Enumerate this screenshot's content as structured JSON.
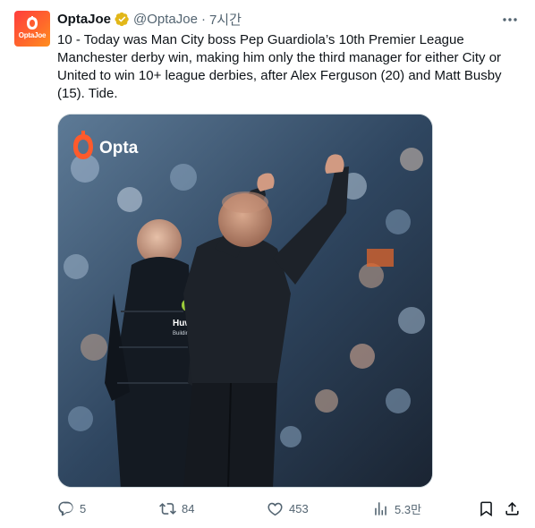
{
  "author": {
    "name": "OptaJoe",
    "handle": "@OptaJoe",
    "separator": "·",
    "time": "7시간",
    "avatar_text": "OptaJoe",
    "verified": true
  },
  "tweet": {
    "text": "10 - Today was Man City boss Pep Guardiola’s 10th Premier League Manchester derby win, making him only the third manager for either City or United to win 10+ league derbies, after Alex Ferguson (20) and Matt Busby (15). Tide."
  },
  "media": {
    "watermark": "Opta",
    "sponsor_text": "Huw",
    "sponsor_sub": "Buildin"
  },
  "actions": {
    "replies": "5",
    "retweets": "84",
    "likes": "453",
    "views": "5.3만"
  },
  "colors": {
    "accent": "#ff4b2b",
    "secondary_text": "#536471",
    "verified_gold": "#e2b719"
  },
  "icons": [
    "more-icon",
    "verified-icon",
    "reply-icon",
    "retweet-icon",
    "like-icon",
    "views-icon",
    "bookmark-icon",
    "share-icon"
  ]
}
